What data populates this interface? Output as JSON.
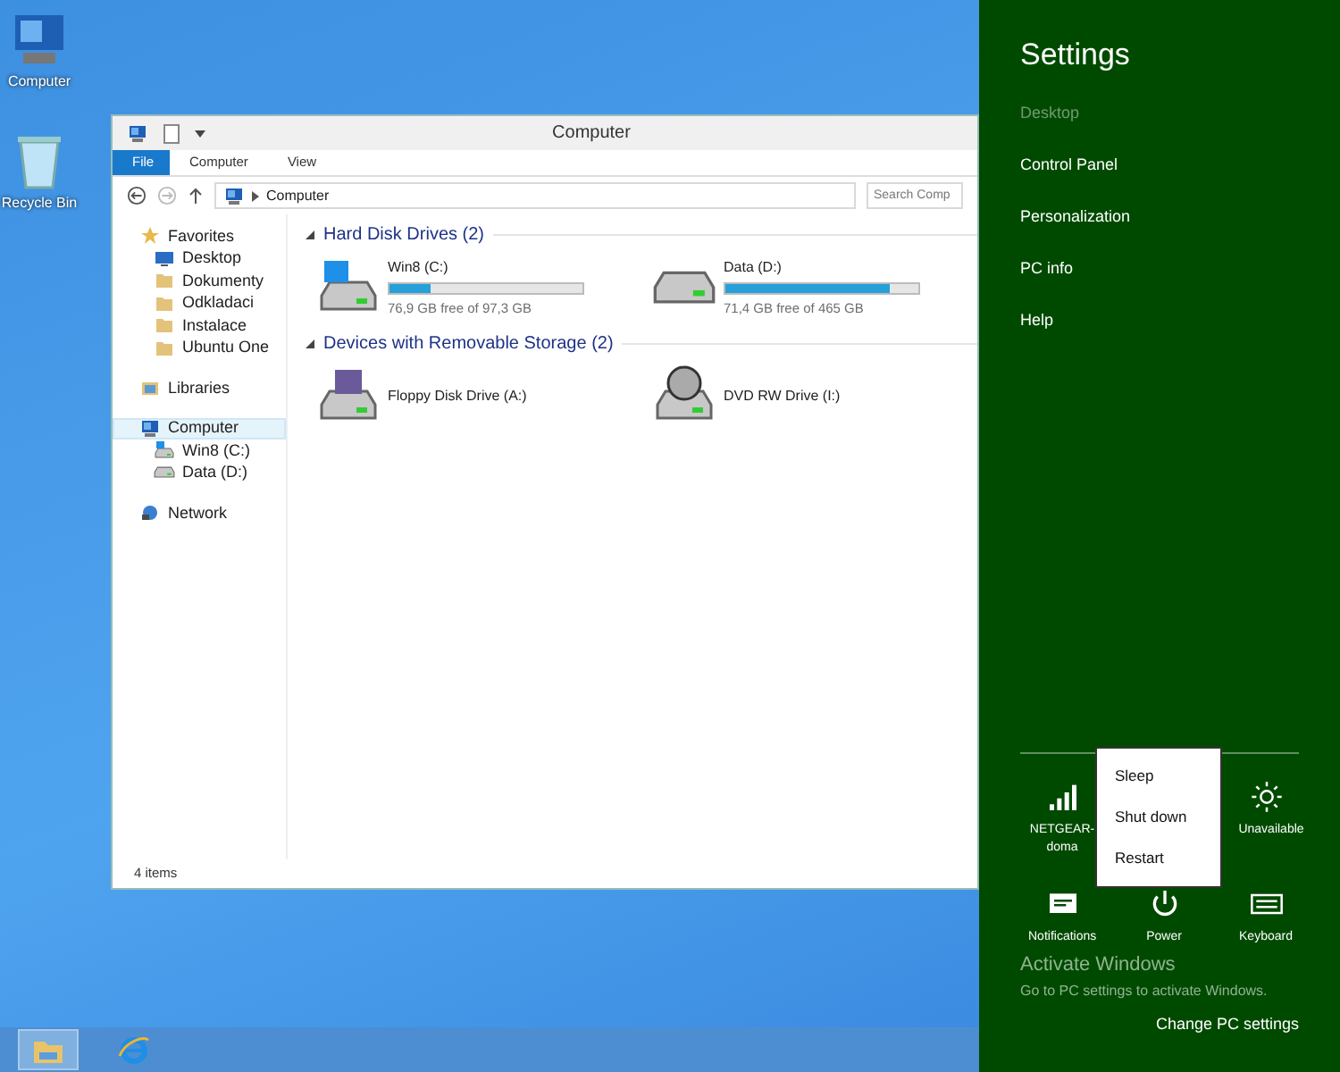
{
  "desktop_icons": [
    {
      "label": "Computer",
      "kind": "computer"
    },
    {
      "label": "Recycle Bin",
      "kind": "bin"
    }
  ],
  "explorer": {
    "title": "Computer",
    "ribbon_tabs": [
      {
        "label": "File",
        "selected": true
      },
      {
        "label": "Computer",
        "selected": false
      },
      {
        "label": "View",
        "selected": false
      }
    ],
    "address": "Computer",
    "search": {
      "placeholder": "Search Comp"
    },
    "nav": [
      {
        "label": "Favorites",
        "kind": "star",
        "selected": false,
        "children": [
          {
            "label": "Desktop",
            "kind": "desktop",
            "selected": false
          },
          {
            "label": "Dokumenty",
            "kind": "folder",
            "selected": false
          },
          {
            "label": "Odkladaci",
            "kind": "folder",
            "selected": false
          },
          {
            "label": "Instalace",
            "kind": "folder",
            "selected": false
          },
          {
            "label": "Ubuntu One",
            "kind": "folder",
            "selected": false
          }
        ]
      },
      {
        "label": "Libraries",
        "kind": "library",
        "selected": false
      },
      {
        "label": "Computer",
        "kind": "computer",
        "selected": true,
        "children": [
          {
            "label": "Win8 (C:)",
            "kind": "windrive",
            "selected": false
          },
          {
            "label": "Data (D:)",
            "kind": "drive",
            "selected": false
          }
        ]
      },
      {
        "label": "Network",
        "kind": "network",
        "selected": false
      }
    ],
    "groups": [
      {
        "title": "Hard Disk Drives (2)",
        "items": [
          {
            "name": "Win8 (C:)",
            "kind": "windrive",
            "level": 0.21,
            "free": "76,9 GB free of 97,3 GB"
          },
          {
            "name": "Data (D:)",
            "kind": "drive",
            "level": 0.85,
            "free": "71,4 GB free of 465 GB"
          }
        ]
      },
      {
        "title": "Devices with Removable Storage (2)",
        "items": [
          {
            "name": "Floppy Disk Drive (A:)",
            "kind": "floppy"
          },
          {
            "name": "DVD RW Drive (I:)",
            "kind": "dvd"
          }
        ]
      }
    ],
    "status": "4 items"
  },
  "taskbar": [
    {
      "kind": "explorer",
      "selected": true
    },
    {
      "kind": "ie",
      "selected": false
    }
  ],
  "charm": {
    "title": "Settings",
    "items": [
      {
        "label": "Desktop",
        "disabled": true
      },
      {
        "label": "Control Panel",
        "disabled": false
      },
      {
        "label": "Personalization",
        "disabled": false
      },
      {
        "label": "PC info",
        "disabled": false
      },
      {
        "label": "Help",
        "disabled": false
      }
    ],
    "quick": [
      {
        "label": "NETGEAR-doma",
        "kind": "signal"
      },
      {
        "label": "Unavailable",
        "kind": "brightness"
      },
      {
        "label": "Notifications",
        "kind": "notifications"
      },
      {
        "label": "Power",
        "kind": "power"
      },
      {
        "label": "Keyboard",
        "kind": "keyboard"
      }
    ],
    "power_menu": [
      "Sleep",
      "Shut down",
      "Restart"
    ],
    "activation": [
      "Activate Windows",
      "Go to PC settings to activate Windows."
    ],
    "change_settings": "Change PC settings"
  }
}
